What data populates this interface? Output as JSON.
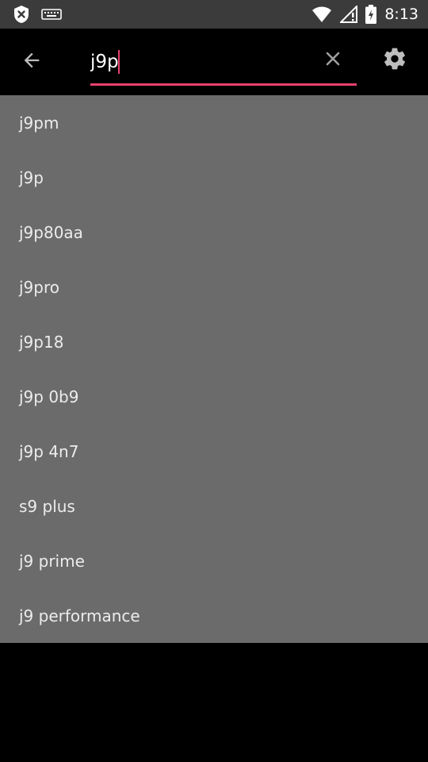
{
  "status_bar": {
    "time": "8:13",
    "icons": [
      "shield-icon",
      "keyboard-icon",
      "wifi-icon",
      "signal-no-data-icon",
      "battery-icon"
    ]
  },
  "search": {
    "query": "j9p",
    "back_icon": "arrow-left-icon",
    "clear_icon": "close-icon",
    "settings_icon": "gear-icon",
    "accent_color": "#e8426e"
  },
  "suggestions": [
    {
      "label": "j9pm"
    },
    {
      "label": "j9p"
    },
    {
      "label": "j9p80aa"
    },
    {
      "label": "j9pro"
    },
    {
      "label": "j9p18"
    },
    {
      "label": "j9p 0b9"
    },
    {
      "label": "j9p 4n7"
    },
    {
      "label": "s9 plus"
    },
    {
      "label": "j9 prime"
    },
    {
      "label": "j9 performance"
    }
  ]
}
